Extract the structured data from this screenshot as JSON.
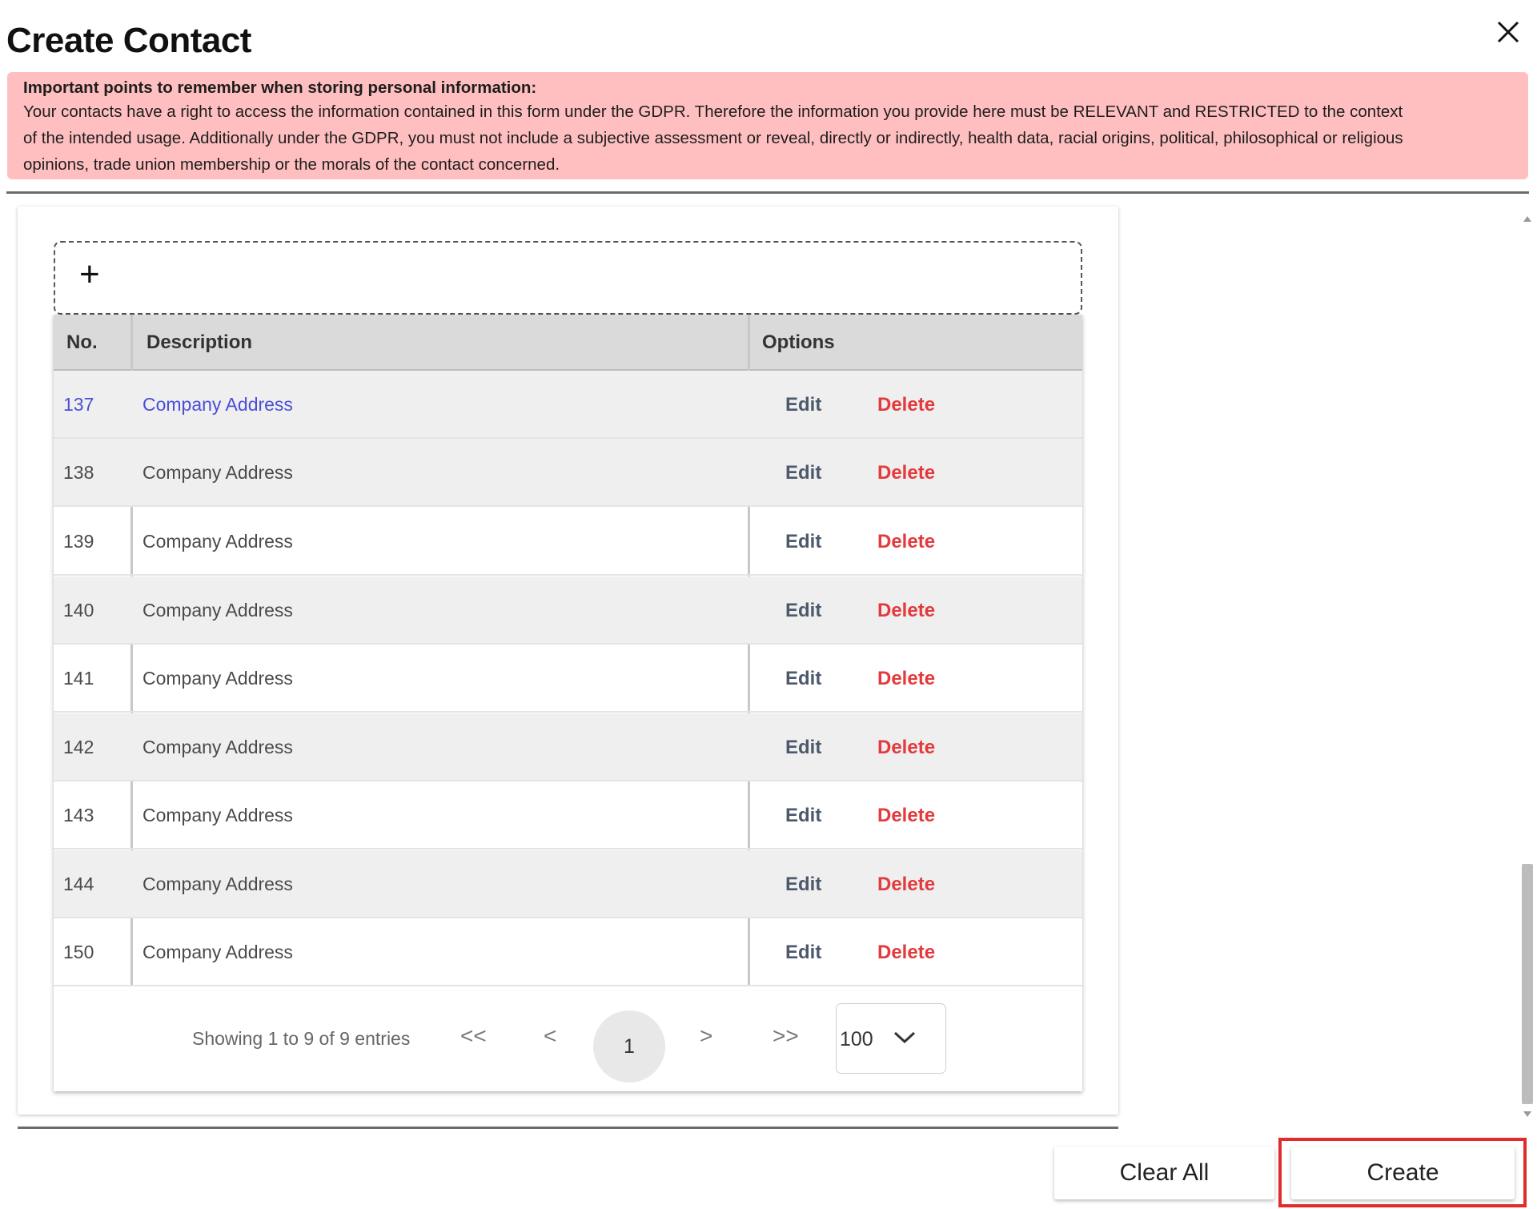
{
  "dialog": {
    "title": "Create Contact"
  },
  "gdpr": {
    "title": "Important points to remember when storing personal information:",
    "lines": [
      "Your contacts have a right to access the information contained in this form under the GDPR. Therefore the information you provide here must be RELEVANT and RESTRICTED to the context",
      "of the intended usage. Additionally under the GDPR, you must not include a subjective assessment or reveal, directly or indirectly, health data, racial origins, political, philosophical or religious",
      "opinions, trade union membership or the morals of the contact concerned."
    ]
  },
  "add_zone": {
    "icon": "plus-icon",
    "symbol": "+"
  },
  "table": {
    "headers": {
      "no": "No.",
      "description": "Description",
      "options": "Options"
    },
    "rows": [
      {
        "no": "137",
        "description": "Company Address",
        "edit": "Edit",
        "delete": "Delete"
      },
      {
        "no": "138",
        "description": "Company Address",
        "edit": "Edit",
        "delete": "Delete"
      },
      {
        "no": "139",
        "description": "Company Address",
        "edit": "Edit",
        "delete": "Delete"
      },
      {
        "no": "140",
        "description": "Company Address",
        "edit": "Edit",
        "delete": "Delete"
      },
      {
        "no": "141",
        "description": "Company Address",
        "edit": "Edit",
        "delete": "Delete"
      },
      {
        "no": "142",
        "description": "Company Address",
        "edit": "Edit",
        "delete": "Delete"
      },
      {
        "no": "143",
        "description": "Company Address",
        "edit": "Edit",
        "delete": "Delete"
      },
      {
        "no": "144",
        "description": "Company Address",
        "edit": "Edit",
        "delete": "Delete"
      },
      {
        "no": "150",
        "description": "Company Address",
        "edit": "Edit",
        "delete": "Delete"
      }
    ]
  },
  "pagination": {
    "info": "Showing 1 to 9 of 9 entries",
    "first": "<<",
    "prev": "<",
    "current_page": "1",
    "next": ">",
    "last": ">>",
    "page_size": "100"
  },
  "footer": {
    "clear_label": "Clear All",
    "create_label": "Create"
  },
  "colors": {
    "notice_bg": "#ffbfc0",
    "selected_link": "#4b4fd6",
    "delete": "#e33a3d",
    "edit": "#4d5a6c",
    "highlight": "#e22b2b"
  }
}
